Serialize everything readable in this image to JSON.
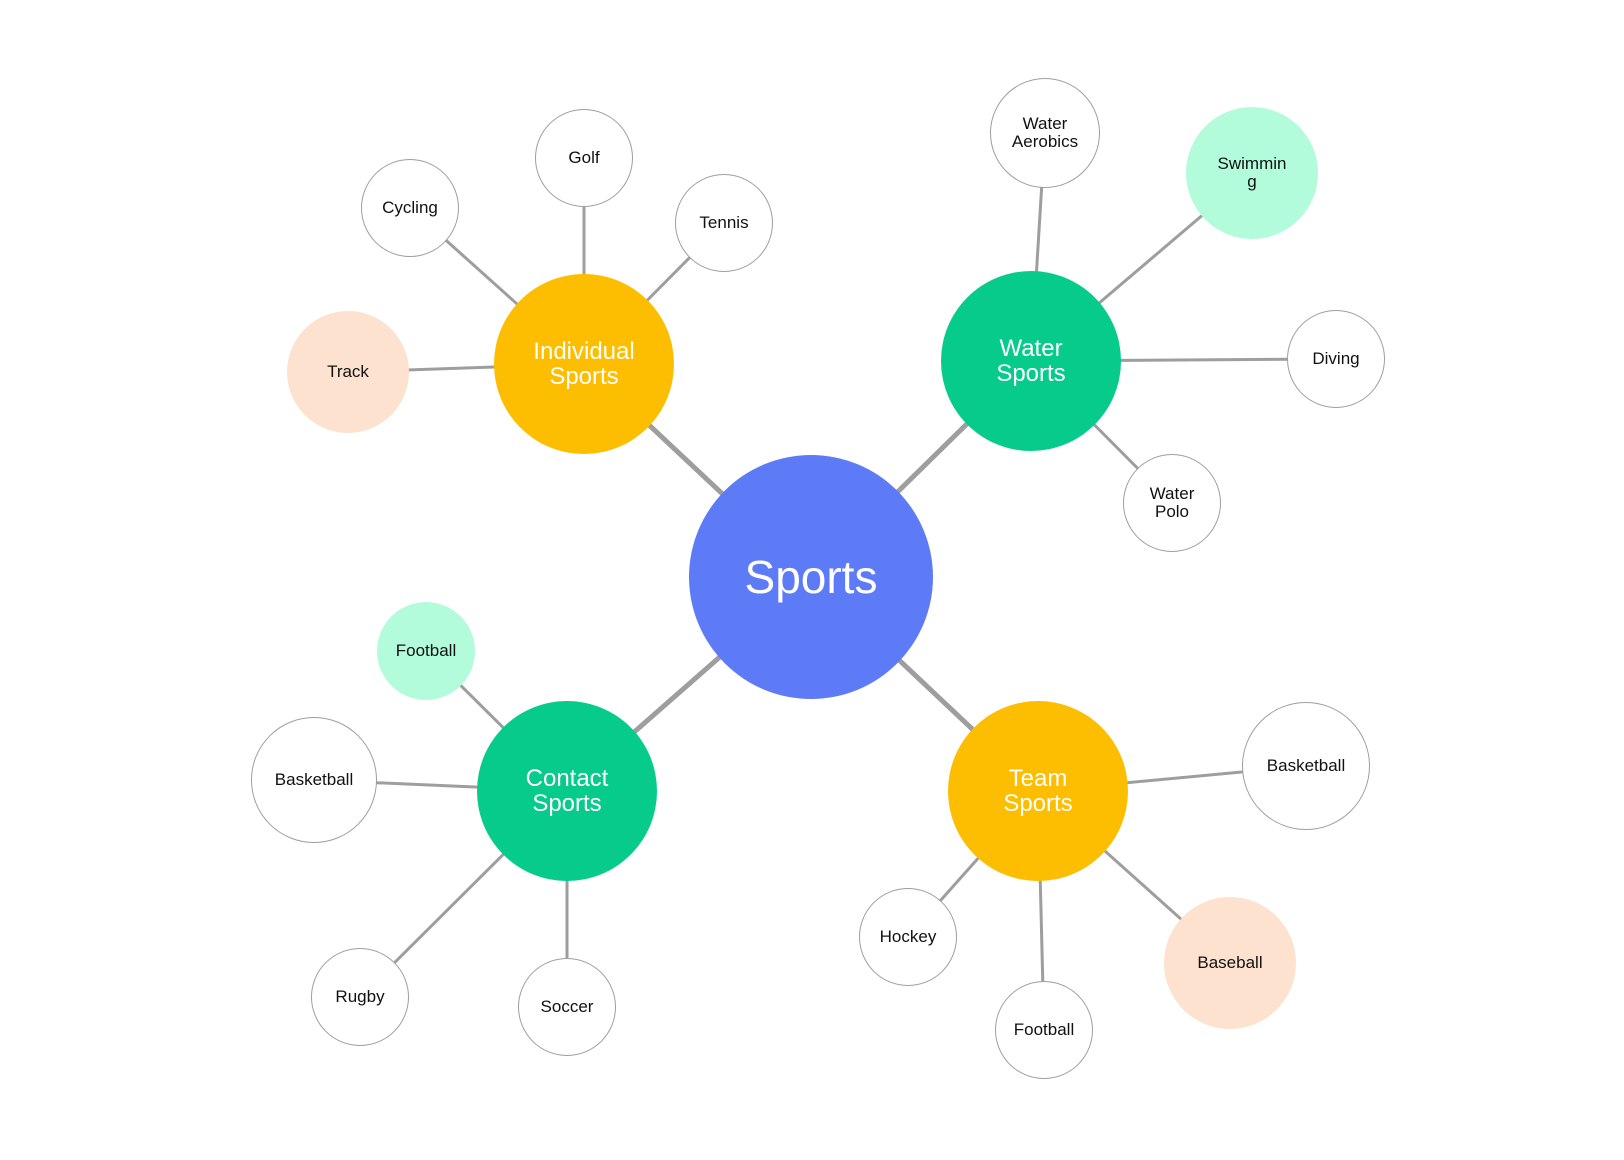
{
  "diagram": {
    "type": "mind-map",
    "root": {
      "id": "root",
      "label": "Sports",
      "color": "#5e7bf7"
    },
    "categories": [
      {
        "id": "individual",
        "label": "Individual\nSports",
        "color": "#fdbd00",
        "children": [
          {
            "label": "Track",
            "fill": "#fde2cf"
          },
          {
            "label": "Cycling",
            "fill": "#ffffff"
          },
          {
            "label": "Golf",
            "fill": "#ffffff"
          },
          {
            "label": "Tennis",
            "fill": "#ffffff"
          }
        ]
      },
      {
        "id": "water",
        "label": "Water\nSports",
        "color": "#06cb8a",
        "children": [
          {
            "label": "Water\nAerobics",
            "fill": "#ffffff"
          },
          {
            "label": "Swimmin\ng",
            "fill": "#b2fcdb"
          },
          {
            "label": "Diving",
            "fill": "#ffffff"
          },
          {
            "label": "Water\nPolo",
            "fill": "#ffffff"
          }
        ]
      },
      {
        "id": "contact",
        "label": "Contact\nSports",
        "color": "#06cb8a",
        "children": [
          {
            "label": "Football",
            "fill": "#b2fcdb"
          },
          {
            "label": "Basketball",
            "fill": "#ffffff"
          },
          {
            "label": "Rugby",
            "fill": "#ffffff"
          },
          {
            "label": "Soccer",
            "fill": "#ffffff"
          }
        ]
      },
      {
        "id": "team",
        "label": "Team\nSports",
        "color": "#fdbd00",
        "children": [
          {
            "label": "Basketball",
            "fill": "#ffffff"
          },
          {
            "label": "Hockey",
            "fill": "#ffffff"
          },
          {
            "label": "Football",
            "fill": "#ffffff"
          },
          {
            "label": "Baseball",
            "fill": "#fde2cf"
          }
        ]
      }
    ],
    "edge_color": "#9e9e9e"
  }
}
